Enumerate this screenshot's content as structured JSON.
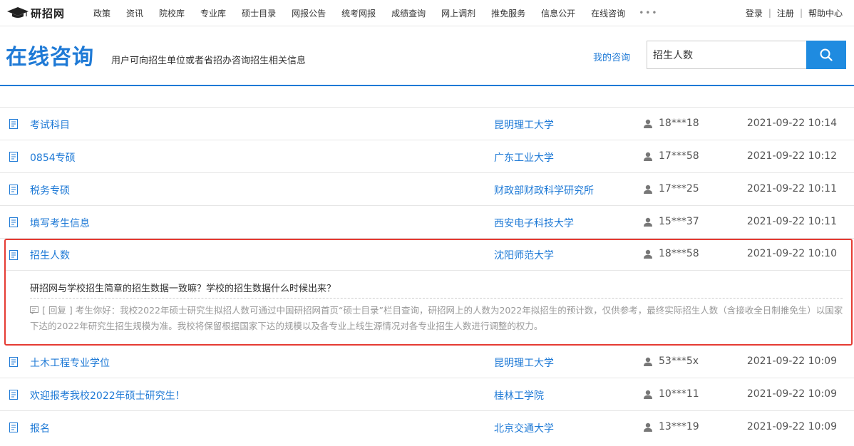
{
  "brand": {
    "name": "研招网"
  },
  "nav": [
    "政策",
    "资讯",
    "院校库",
    "专业库",
    "硕士目录",
    "网报公告",
    "统考网报",
    "成绩查询",
    "网上调剂",
    "推免服务",
    "信息公开",
    "在线咨询"
  ],
  "nav_more": "•••",
  "auth": {
    "login": "登录",
    "sep1": "|",
    "register": "注册",
    "sep2": "|",
    "help": "帮助中心"
  },
  "header": {
    "title": "在线咨询",
    "subtitle": "用户可向招生单位或者省招办咨询招生相关信息",
    "my_consult": "我的咨询",
    "search_value": "招生人数"
  },
  "rows": [
    {
      "q": "考试科目",
      "school": "昆明理工大学",
      "user": "18***18",
      "time": "2021-09-22 10:14"
    },
    {
      "q": "0854专硕",
      "school": "广东工业大学",
      "user": "17***58",
      "time": "2021-09-22 10:12"
    },
    {
      "q": "税务专硕",
      "school": "财政部财政科学研究所",
      "user": "17***25",
      "time": "2021-09-22 10:11"
    },
    {
      "q": "填写考生信息",
      "school": "西安电子科技大学",
      "user": "15***37",
      "time": "2021-09-22 10:11"
    }
  ],
  "expanded": {
    "q": "招生人数",
    "school": "沈阳师范大学",
    "user": "18***58",
    "time": "2021-09-22 10:10",
    "question": "研招网与学校招生简章的招生数据一致嘛？学校的招生数据什么时候出来？",
    "reply_tag": "[ 回复 ]",
    "reply": "考生你好：我校2022年硕士研究生拟招人数可通过中国研招网首页“硕士目录”栏目查询，研招网上的人数为2022年拟招生的预计数，仅供参考，最终实际招生人数（含接收全日制推免生）以国家下达的2022年研究生招生规模为准。我校将保留根据国家下达的规模以及各专业上线生源情况对各专业招生人数进行调整的权力。"
  },
  "rows_after": [
    {
      "q": "土木工程专业学位",
      "school": "昆明理工大学",
      "user": "53***5x",
      "time": "2021-09-22 10:09"
    },
    {
      "q": "欢迎报考我校2022年硕士研究生！",
      "school": "桂林工学院",
      "user": "10***11",
      "time": "2021-09-22 10:09"
    },
    {
      "q": "报名",
      "school": "北京交通大学",
      "user": "13***19",
      "time": "2021-09-22 10:09"
    }
  ]
}
